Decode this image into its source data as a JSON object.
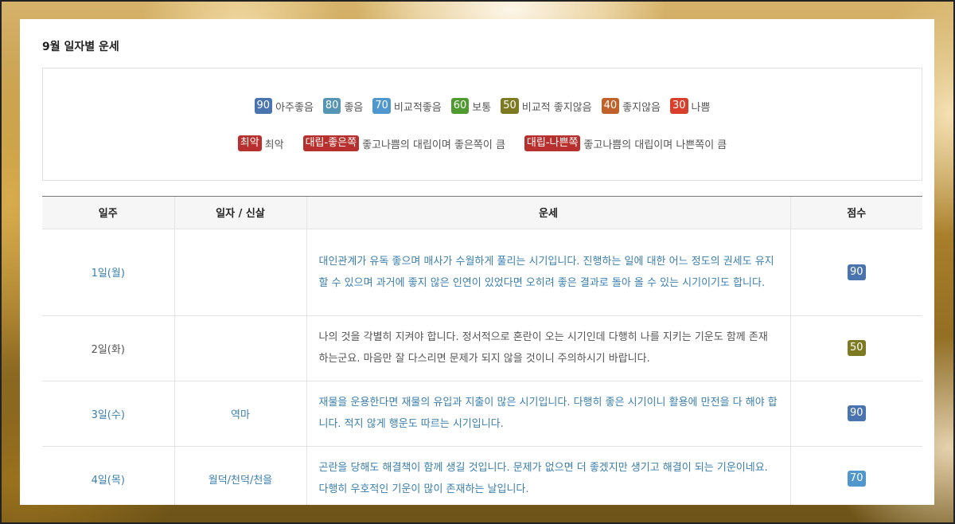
{
  "title": "9월 일자별 운세",
  "legend": {
    "row1": [
      {
        "badge": "90",
        "label": "아주좋음",
        "color": "#4a74b0"
      },
      {
        "badge": "80",
        "label": "좋음",
        "color": "#5795b4"
      },
      {
        "badge": "70",
        "label": "비교적좋음",
        "color": "#4f97cc"
      },
      {
        "badge": "60",
        "label": "보통",
        "color": "#4e9a2e"
      },
      {
        "badge": "50",
        "label": "비교적 좋지않음",
        "color": "#7d7a22"
      },
      {
        "badge": "40",
        "label": "좋지않음",
        "color": "#c0602a"
      },
      {
        "badge": "30",
        "label": "나쁨",
        "color": "#d9402c"
      }
    ],
    "row2": [
      {
        "badge": "최악",
        "label": "최악",
        "color": "#b8302e"
      },
      {
        "badge": "대립-좋은쪽",
        "label": "좋고나쁨의 대립이며 좋은쪽이 큼",
        "color": "#b8302e"
      },
      {
        "badge": "대립-나쁜쪽",
        "label": "좋고나쁨의 대립이며 나쁜쪽이 큼",
        "color": "#b8302e"
      }
    ]
  },
  "table": {
    "headers": [
      "일주",
      "일자 / 신살",
      "운세",
      "점수"
    ],
    "rows": [
      {
        "day": "1일(월)",
        "shinsal": "",
        "fortune": "대인관계가 유독 좋으며 매사가 수월하게 풀리는 시기입니다. 진행하는 일에 대한 어느 정도의 권세도 유지할 수 있으며 과거에 좋지 않은 인연이 있었다면 오히려 좋은 결과로 돌아 올 수 있는 시기이기도 합니다.",
        "score": "90",
        "score_color": "#4a74b0",
        "tone": "blue"
      },
      {
        "day": "2일(화)",
        "shinsal": "",
        "fortune": "나의 것을 각별히 지켜야 합니다. 정서적으로 혼란이 오는 시기인데 다행히 나를 지키는 기운도 함께 존재 하는군요. 마음만 잘 다스리면 문제가 되지 않을 것이니 주의하시기 바랍니다.",
        "score": "50",
        "score_color": "#7d7a22",
        "tone": "gray"
      },
      {
        "day": "3일(수)",
        "shinsal": "역마",
        "fortune": "재물을 운용한다면 재물의 유입과 지출이 많은 시기입니다. 다행히 좋은 시기이니 활용에 만전을 다 해야 합니다. 적지 않게 행운도 따르는 시기입니다.",
        "score": "90",
        "score_color": "#4a74b0",
        "tone": "blue"
      },
      {
        "day": "4일(목)",
        "shinsal": "월덕/천덕/천을",
        "fortune": "곤란을 당해도 해결책이 함께 생길 것입니다. 문제가 없으면 더 좋겠지만 생기고 해결이 되는 기운이네요. 다행히 우호적인 기운이 많이 존재하는 날입니다.",
        "score": "70",
        "score_color": "#4f97cc",
        "tone": "blue"
      }
    ]
  }
}
